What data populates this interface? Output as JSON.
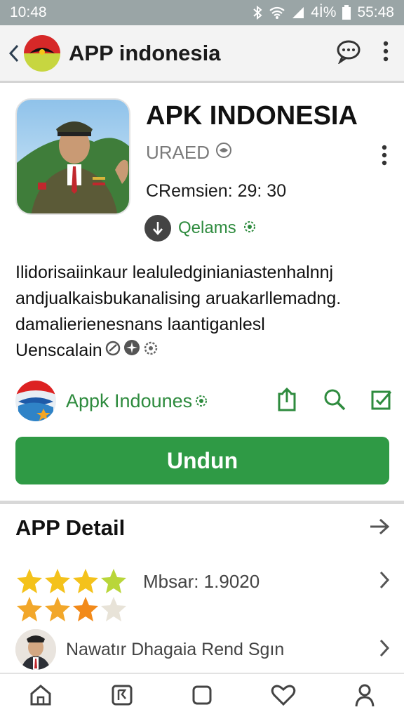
{
  "status_bar": {
    "time": "10:48",
    "battery": "4İ%",
    "clock_right": "55:48"
  },
  "app_bar": {
    "title": "APP indonesia"
  },
  "app": {
    "title": "APK INDONESIA",
    "subtitle": "URAED",
    "version": "CRemsien: 29: 30",
    "download_label": "Qelams"
  },
  "description": {
    "lines": [
      "Ilidorisaiinkaur lealuledginianiastenhalnnj",
      "andjualkaisbukanalising aruakarllemadng.",
      "damalierienesnans laantiganlesl",
      "Uenscalain"
    ]
  },
  "developer": {
    "name": "Appk Indounes"
  },
  "install_button": "Undun",
  "detail": {
    "title": "APP Detail",
    "rating_text": "Mbsar: 1.9020",
    "review_text": "Nawatır Dhagaia Rend Sgın"
  },
  "colors": {
    "accent_green": "#2f9a45",
    "text_green": "#2e8b3e",
    "star": "#f4b51b"
  },
  "icons": [
    "back-icon",
    "chat-icon",
    "more-vert-icon",
    "download-icon",
    "share-icon",
    "search-icon",
    "edit-check-icon",
    "arrow-right-icon",
    "chevron-right-icon",
    "home-icon",
    "library-icon",
    "square-icon",
    "heart-icon",
    "person-icon"
  ]
}
